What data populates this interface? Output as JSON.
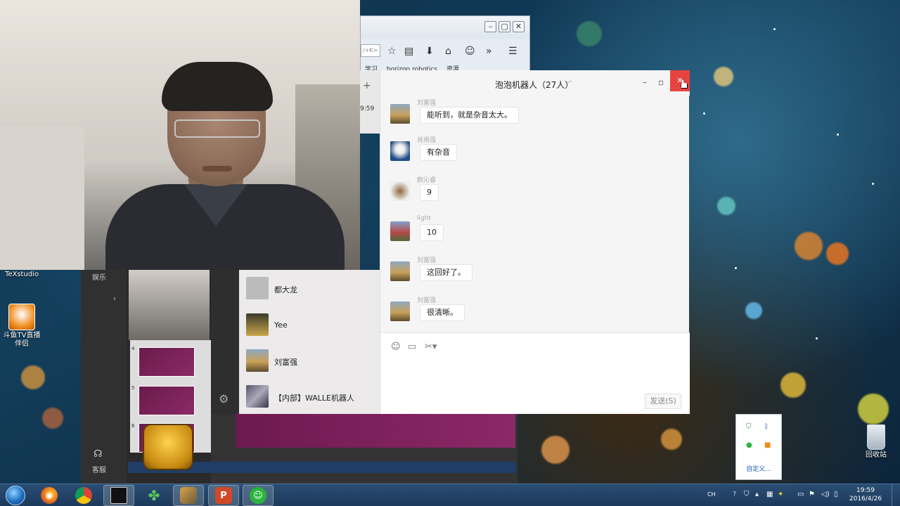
{
  "desktop": {
    "icons": [
      {
        "label": "TeXstudio"
      },
      {
        "label": "斗鱼TV直播伴侣"
      },
      {
        "label": "回收站"
      }
    ]
  },
  "browser": {
    "url_fragment": "/+K>",
    "bookmarks": [
      "学习",
      "horizon robotics",
      "资源"
    ],
    "time_fragment": "9:59"
  },
  "wechat": {
    "title": "泡泡机器人（27人）",
    "messages": [
      {
        "sender": "刘富强",
        "text": "能听到，就是杂音太大。"
      },
      {
        "sender": "肖雨强",
        "text": "有杂音"
      },
      {
        "sender": "颜沁睿",
        "text": "9"
      },
      {
        "sender": "light",
        "text": "10"
      },
      {
        "sender": "刘富强",
        "text": "这回好了。"
      },
      {
        "sender": "刘富强",
        "text": "很清晰。"
      }
    ],
    "send_label": "发送(S)",
    "contacts": [
      {
        "name": "都大龙"
      },
      {
        "name": "Yee"
      },
      {
        "name": "刘富强"
      },
      {
        "name": "【内部】WALLE机器人"
      }
    ]
  },
  "studio": {
    "nav_top": "娱乐",
    "nav_bottom": "客服",
    "slide_numbers": [
      "4",
      "5",
      "6"
    ]
  },
  "tray_popup": {
    "customize": "自定义..."
  },
  "taskbar": {
    "lang": "CH",
    "time": "19:59",
    "date": "2016/4/26"
  }
}
